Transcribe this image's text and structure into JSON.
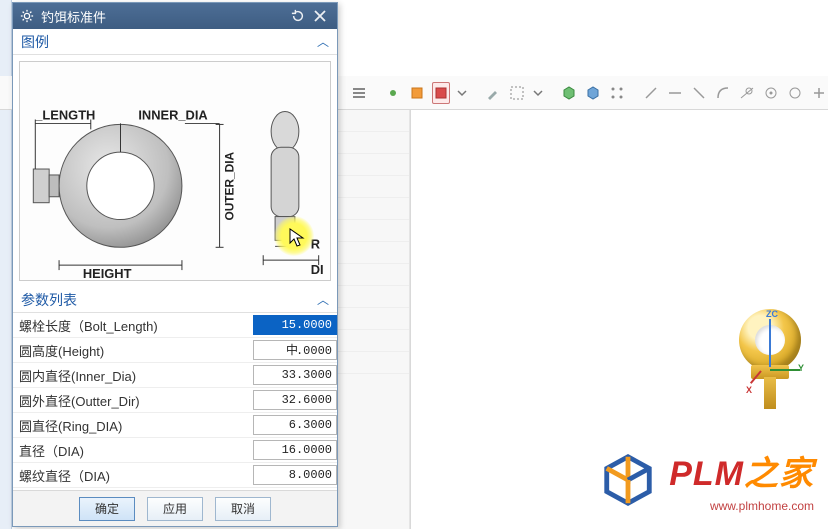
{
  "dialog": {
    "title": "钓饵标准件",
    "section_diagram": "图例",
    "section_params": "参数列表",
    "diagram_labels": {
      "length": "_LENGTH",
      "inner": "INNER_DIA",
      "outer": "OUTER_DIA",
      "height": "HEIGHT",
      "r": "R",
      "di": "DI"
    },
    "params": [
      {
        "name": "螺栓长度（Bolt_Length)",
        "value": "15.0000",
        "selected": true
      },
      {
        "name": "圆高度(Height)",
        "value": ".0000",
        "cursor": "中"
      },
      {
        "name": "圆内直径(Inner_Dia)",
        "value": "33.3000"
      },
      {
        "name": "圆外直径(Outter_Dir)",
        "value": "32.6000"
      },
      {
        "name": "圆直径(Ring_DIA)",
        "value": "6.3000"
      },
      {
        "name": "直径（DIA)",
        "value": "16.0000"
      },
      {
        "name": "螺纹直径（DIA)",
        "value": "8.0000"
      }
    ],
    "buttons": {
      "ok": "确定",
      "apply": "应用",
      "cancel": "取消"
    }
  },
  "watermark": {
    "brand_a": "PLM",
    "brand_b": "之家",
    "url": "www.plmhome.com"
  },
  "axes": {
    "x": "X",
    "y": "Y",
    "z": "ZC"
  }
}
